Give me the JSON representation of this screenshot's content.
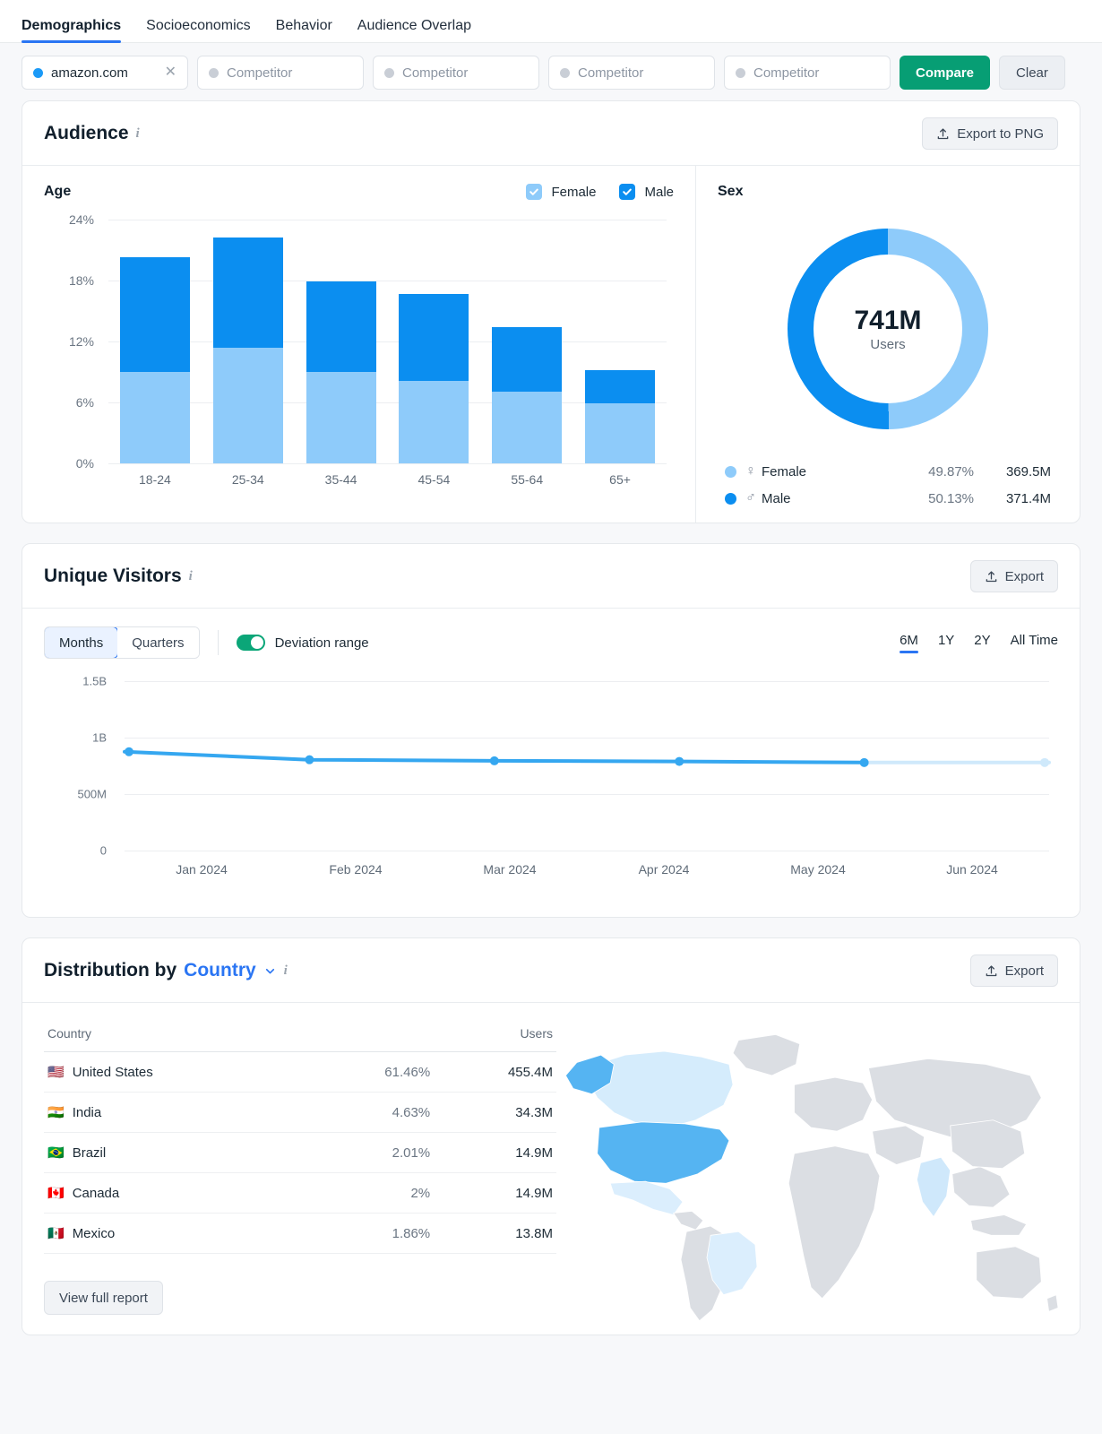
{
  "tabs": [
    {
      "label": "Demographics",
      "active": true
    },
    {
      "label": "Socioeconomics",
      "active": false
    },
    {
      "label": "Behavior",
      "active": false
    },
    {
      "label": "Audience Overlap",
      "active": false
    }
  ],
  "competitor_bar": {
    "chips": [
      {
        "value": "amazon.com",
        "filled": true
      },
      {
        "value": "Competitor",
        "filled": false
      },
      {
        "value": "Competitor",
        "filled": false
      },
      {
        "value": "Competitor",
        "filled": false
      },
      {
        "value": "Competitor",
        "filled": false
      }
    ],
    "compare_label": "Compare",
    "clear_label": "Clear"
  },
  "audience": {
    "title": "Audience",
    "export_label": "Export to PNG",
    "age": {
      "title": "Age",
      "legend": [
        {
          "label": "Female",
          "checked": true,
          "color": "#8ecbfa"
        },
        {
          "label": "Male",
          "checked": true,
          "color": "#0b8ef0"
        }
      ]
    },
    "sex": {
      "title": "Sex",
      "center_value": "741M",
      "center_label": "Users",
      "rows": [
        {
          "symbol": "♀",
          "name": "Female",
          "pct": "49.87%",
          "users": "369.5M",
          "color": "#8ecbfa"
        },
        {
          "symbol": "♂",
          "name": "Male",
          "pct": "50.13%",
          "users": "371.4M",
          "color": "#0b8ef0"
        }
      ]
    }
  },
  "unique_visitors": {
    "title": "Unique Visitors",
    "export_label": "Export",
    "granularity": [
      {
        "label": "Months",
        "selected": true
      },
      {
        "label": "Quarters",
        "selected": false
      }
    ],
    "deviation_label": "Deviation range",
    "deviation_on": true,
    "ranges": [
      {
        "label": "6M",
        "selected": true
      },
      {
        "label": "1Y",
        "selected": false
      },
      {
        "label": "2Y",
        "selected": false
      },
      {
        "label": "All Time",
        "selected": false
      }
    ]
  },
  "distribution": {
    "title_prefix": "Distribution by",
    "title_dim": "Country",
    "export_label": "Export",
    "columns": [
      "Country",
      "Users"
    ],
    "rows": [
      {
        "flag": "🇺🇸",
        "country": "United States",
        "pct": "61.46%",
        "users": "455.4M"
      },
      {
        "flag": "🇮🇳",
        "country": "India",
        "pct": "4.63%",
        "users": "34.3M"
      },
      {
        "flag": "🇧🇷",
        "country": "Brazil",
        "pct": "2.01%",
        "users": "14.9M"
      },
      {
        "flag": "🇨🇦",
        "country": "Canada",
        "pct": "2%",
        "users": "14.9M"
      },
      {
        "flag": "🇲🇽",
        "country": "Mexico",
        "pct": "1.86%",
        "users": "13.8M"
      }
    ],
    "view_full_report_label": "View full report"
  },
  "colors": {
    "female": "#8ecbfa",
    "male": "#0b8ef0",
    "accent": "#2a75f3",
    "green": "#079e74",
    "line": "#35a7f0",
    "line_forecast": "#cfe9fb"
  },
  "chart_data": [
    {
      "type": "bar",
      "id": "age-distribution",
      "title": "Age",
      "stacked": true,
      "categories": [
        "18-24",
        "25-34",
        "35-44",
        "45-54",
        "55-64",
        "65+"
      ],
      "series": [
        {
          "name": "Female",
          "color": "#8ecbfa",
          "values": [
            9.0,
            11.4,
            9.0,
            8.1,
            7.1,
            5.9
          ]
        },
        {
          "name": "Male",
          "color": "#0b8ef0",
          "values": [
            11.3,
            10.8,
            8.9,
            8.6,
            6.3,
            3.3
          ]
        }
      ],
      "totals": [
        20.3,
        22.2,
        17.9,
        16.7,
        13.4,
        9.2
      ],
      "ylabel": "",
      "xlabel": "",
      "ytick_labels": [
        "0%",
        "6%",
        "12%",
        "18%",
        "24%"
      ],
      "yticks": [
        0,
        6,
        12,
        18,
        24
      ],
      "ylim": [
        0,
        24
      ],
      "grid": true,
      "legend_position": "top-right"
    },
    {
      "type": "pie",
      "id": "sex-distribution",
      "title": "Sex",
      "donut": true,
      "center_value": "741M",
      "center_label": "Users",
      "labels": [
        "Female",
        "Male"
      ],
      "values": [
        49.87,
        50.13
      ],
      "absolute": [
        "369.5M",
        "371.4M"
      ],
      "colors": [
        "#8ecbfa",
        "#0b8ef0"
      ],
      "legend_position": "bottom"
    },
    {
      "type": "line",
      "id": "unique-visitors-trend",
      "title": "Unique Visitors",
      "x": [
        "Jan 2024",
        "Feb 2024",
        "Mar 2024",
        "Apr 2024",
        "May 2024",
        "Jun 2024"
      ],
      "series": [
        {
          "name": "Unique Visitors",
          "color": "#35a7f0",
          "values": [
            870000000,
            800000000,
            790000000,
            785000000,
            775000000,
            775000000
          ],
          "forecast_from_index": 4
        }
      ],
      "ytick_labels": [
        "0",
        "500M",
        "1B",
        "1.5B"
      ],
      "yticks": [
        0,
        500000000,
        1000000000,
        1500000000
      ],
      "ylim": [
        0,
        1500000000
      ],
      "xlabel": "",
      "ylabel": "",
      "grid": true,
      "legend_position": "none"
    },
    {
      "type": "table",
      "id": "country-distribution",
      "title": "Distribution by Country",
      "columns": [
        "Country",
        "%",
        "Users"
      ],
      "rows": [
        [
          "United States",
          "61.46%",
          "455.4M"
        ],
        [
          "India",
          "4.63%",
          "34.3M"
        ],
        [
          "Brazil",
          "2.01%",
          "14.9M"
        ],
        [
          "Canada",
          "2%",
          "14.9M"
        ],
        [
          "Mexico",
          "1.86%",
          "13.8M"
        ]
      ],
      "map_highlight": {
        "United States": "#55b4f2",
        "Canada": "#d5ecfc",
        "India": "#cfe8fb",
        "Brazil": "#dbeefd",
        "Mexico": "#dbeefd"
      }
    }
  ]
}
